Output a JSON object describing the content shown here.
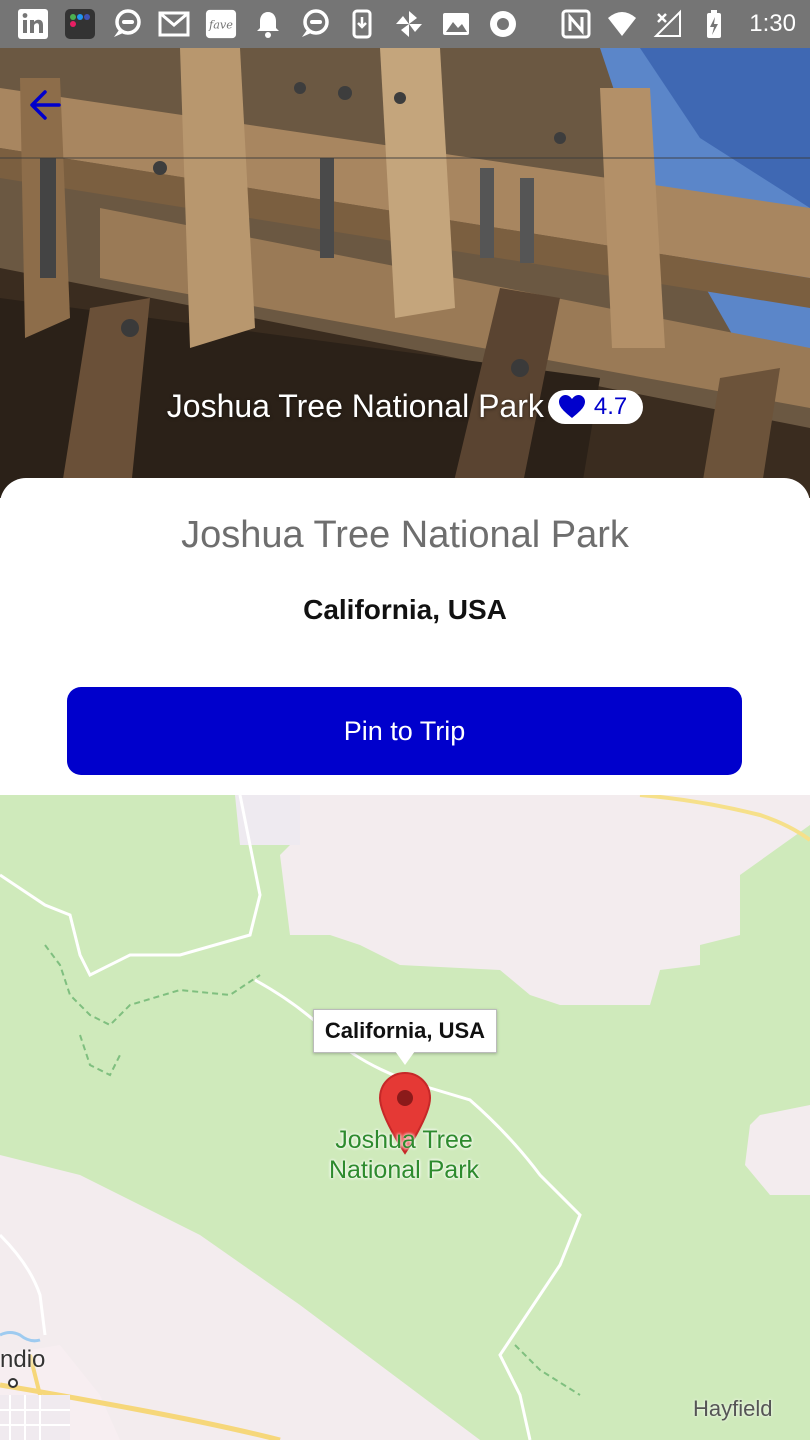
{
  "status_bar": {
    "time": "1:30",
    "icons": [
      "linkedin-icon",
      "app-folder-icon",
      "chat-icon",
      "gmail-icon",
      "fave-icon",
      "notification-bell-icon",
      "chat-icon-2",
      "download-icon",
      "pinwheel-icon",
      "image-icon",
      "record-icon",
      "nfc-icon",
      "wifi-icon",
      "signal-icon",
      "battery-icon"
    ],
    "fave_label": "fave"
  },
  "hero": {
    "title": "Joshua Tree National Park",
    "rating": "4.7",
    "back_icon": "arrow-left-icon"
  },
  "card": {
    "title": "Joshua Tree National Park",
    "subtitle": "California, USA",
    "pin_button_label": "Pin to Trip"
  },
  "map": {
    "tooltip": "California, USA",
    "park_label_line1": "Joshua Tree",
    "park_label_line2": "National Park",
    "town_right": "Hayfield",
    "town_left": "ndio"
  },
  "colors": {
    "accent": "#0000cc",
    "status_bar": "#757575",
    "map_green": "#cfeabb",
    "map_pink": "#f3ecee",
    "pin_red": "#e53935"
  }
}
